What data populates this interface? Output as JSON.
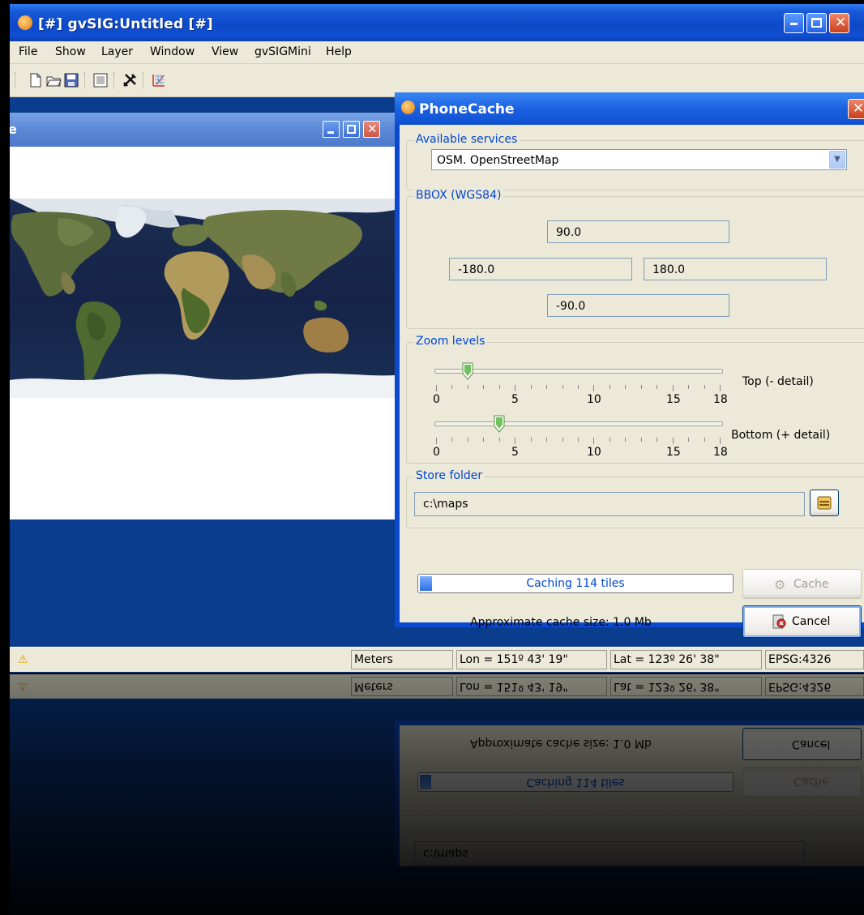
{
  "app": {
    "title": "[#] gvSIG:Untitled [#]",
    "menu": [
      "File",
      "Show",
      "Layer",
      "Window",
      "View",
      "gvSIGMini",
      "Help"
    ],
    "toolbar_icons": [
      "new-icon",
      "open-icon",
      "save-icon",
      "print-icon",
      "tools-icon",
      "grid-icon"
    ],
    "map_frame_title_fragment": "e"
  },
  "dialog": {
    "title": "PhoneCache",
    "services": {
      "legend": "Available services",
      "selected": "OSM. OpenStreetMap"
    },
    "bbox": {
      "legend": "BBOX (WGS84)",
      "north": "90.0",
      "west": "-180.0",
      "east": "180.0",
      "south": "-90.0"
    },
    "zoom": {
      "legend": "Zoom levels",
      "tick_labels": [
        "0",
        "5",
        "10",
        "15",
        "18"
      ],
      "min": 0,
      "max": 18,
      "top_value": 2,
      "top_label": "Top (- detail)",
      "bottom_value": 4,
      "bottom_label": "Bottom (+ detail)"
    },
    "store": {
      "legend": "Store folder",
      "path": "c:\\maps"
    },
    "progress": {
      "text": "Caching 114 tiles",
      "fraction": 0.04
    },
    "cache_size": "Approximate cache size: 1.0 Mb",
    "cache_button": "Cache",
    "cancel_button": "Cancel"
  },
  "status": {
    "units": "Meters",
    "lon": "Lon = 151º 43' 19\"",
    "lat": "Lat = 123º 26' 38\"",
    "crs": "EPSG:4326"
  },
  "colors": {
    "title_blue": "#0d49c8",
    "desktop_blue": "#0a3d8e",
    "legend_blue": "#0046d5",
    "panel": "#ece9d8"
  }
}
